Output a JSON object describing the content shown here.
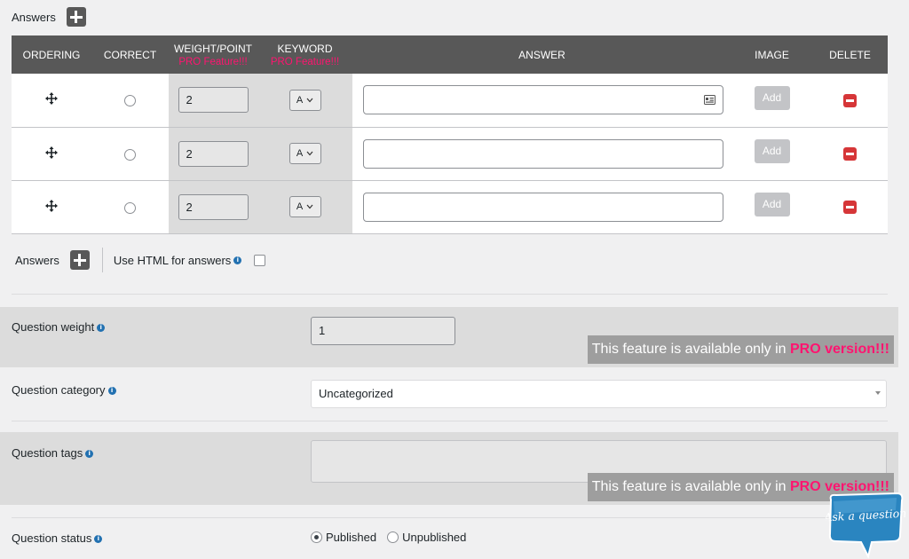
{
  "top": {
    "answers_label": "Answers"
  },
  "table": {
    "headers": {
      "ordering": "ORDERING",
      "correct": "CORRECT",
      "weight": "WEIGHT/POINT",
      "keyword": "KEYWORD",
      "pro_tag": "PRO Feature!!!",
      "answer": "ANSWER",
      "image": "IMAGE",
      "delete": "DELETE"
    },
    "rows": [
      {
        "weight": "2",
        "keyword": "A",
        "answer": "",
        "add_label": "Add"
      },
      {
        "weight": "2",
        "keyword": "A",
        "answer": "",
        "add_label": "Add"
      },
      {
        "weight": "2",
        "keyword": "A",
        "answer": "",
        "add_label": "Add"
      }
    ]
  },
  "answers_bar": {
    "label": "Answers",
    "use_html_label": "Use HTML for answers"
  },
  "question_weight": {
    "label": "Question weight",
    "value": "1"
  },
  "pro_banner": {
    "text": "This feature is available only in ",
    "highlight": "PRO version!!!"
  },
  "question_category": {
    "label": "Question category",
    "selected": "Uncategorized"
  },
  "question_tags": {
    "label": "Question tags"
  },
  "question_status": {
    "label": "Question status",
    "published": "Published",
    "unpublished": "Unpublished"
  },
  "ask": {
    "label": "Ask a question"
  },
  "colors": {
    "header_bg": "#585858",
    "pro_pink": "#ff1470",
    "delete_red": "#d63638",
    "info_blue": "#2271b1"
  }
}
